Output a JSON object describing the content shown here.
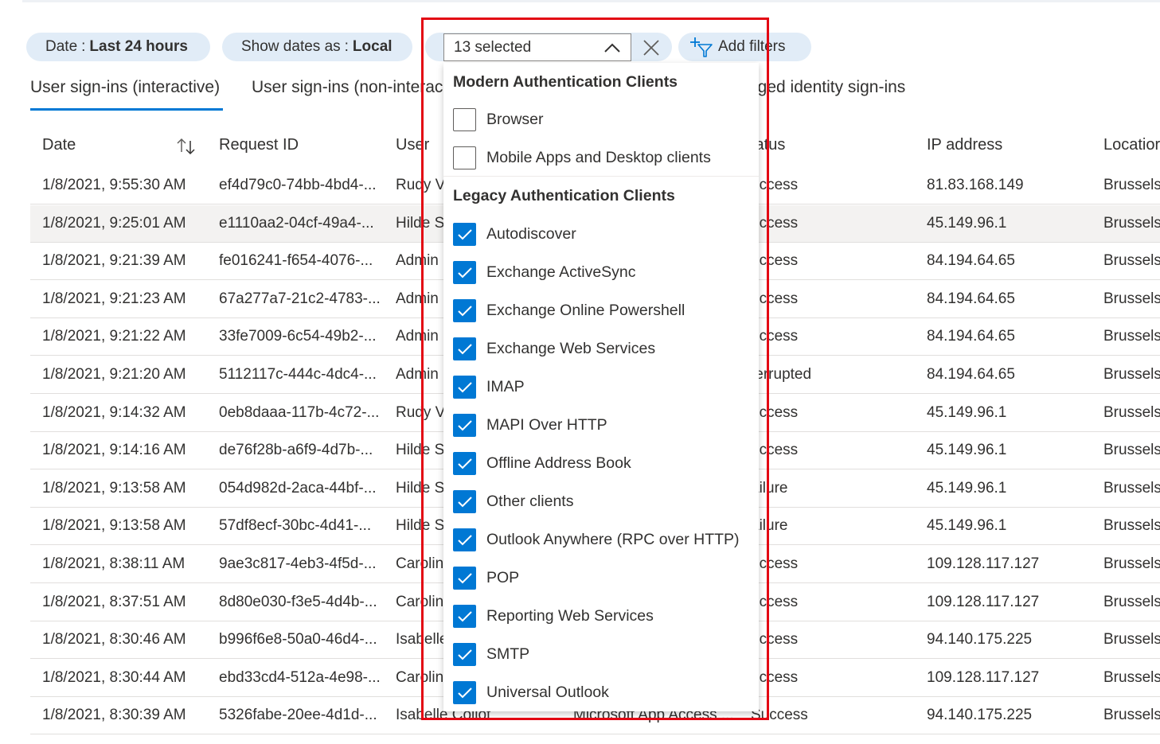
{
  "filters": {
    "date": {
      "key": "Date",
      "sep": ":",
      "value": "Last 24 hours"
    },
    "show_dates": {
      "key": "Show dates as",
      "sep": ":",
      "value": "Local"
    },
    "client_app": {
      "selected_text": "13 selected"
    },
    "add_filters": "Add filters"
  },
  "tabs": [
    {
      "label": "User sign-ins (interactive)"
    },
    {
      "label": "User sign-ins (non-interac"
    },
    {
      "label": "aged identity sign-ins"
    }
  ],
  "table": {
    "columns": [
      "Date",
      "Request ID",
      "User",
      "",
      "tatus",
      "IP address",
      "Locatior"
    ],
    "rows": [
      {
        "date": "1/8/2021, 9:55:30 AM",
        "request_id": "ef4d79c0-74bb-4bd4-...",
        "user": "Rudy V",
        "app": "",
        "status": "uccess",
        "ip": "81.83.168.149",
        "location": "Brussels,"
      },
      {
        "date": "1/8/2021, 9:25:01 AM",
        "request_id": "e1110aa2-04cf-49a4-...",
        "user": "Hilde S",
        "app": "",
        "status": "uccess",
        "ip": "45.149.96.1",
        "location": "Brussels,"
      },
      {
        "date": "1/8/2021, 9:21:39 AM",
        "request_id": "fe016241-f654-4076-...",
        "user": "Admin",
        "app": "",
        "status": "uccess",
        "ip": "84.194.64.65",
        "location": "Brussels,"
      },
      {
        "date": "1/8/2021, 9:21:23 AM",
        "request_id": "67a277a7-21c2-4783-...",
        "user": "Admin",
        "app": "",
        "status": "uccess",
        "ip": "84.194.64.65",
        "location": "Brussels,"
      },
      {
        "date": "1/8/2021, 9:21:22 AM",
        "request_id": "33fe7009-6c54-49b2-...",
        "user": "Admin",
        "app": "",
        "status": "uccess",
        "ip": "84.194.64.65",
        "location": "Brussels,"
      },
      {
        "date": "1/8/2021, 9:21:20 AM",
        "request_id": "5112117c-444c-4dc4-...",
        "user": "Admin",
        "app": "",
        "status": "terrupted",
        "ip": "84.194.64.65",
        "location": "Brussels,"
      },
      {
        "date": "1/8/2021, 9:14:32 AM",
        "request_id": "0eb8daaa-117b-4c72-...",
        "user": "Rudy V",
        "app": "",
        "status": "uccess",
        "ip": "45.149.96.1",
        "location": "Brussels,"
      },
      {
        "date": "1/8/2021, 9:14:16 AM",
        "request_id": "de76f28b-a6f9-4d7b-...",
        "user": "Hilde S",
        "app": "",
        "status": "uccess",
        "ip": "45.149.96.1",
        "location": "Brussels,"
      },
      {
        "date": "1/8/2021, 9:13:58 AM",
        "request_id": "054d982d-2aca-44bf-...",
        "user": "Hilde S",
        "app": "",
        "status": "ailure",
        "ip": "45.149.96.1",
        "location": "Brussels,"
      },
      {
        "date": "1/8/2021, 9:13:58 AM",
        "request_id": "57df8ecf-30bc-4d41-...",
        "user": "Hilde S",
        "app": "",
        "status": "ailure",
        "ip": "45.149.96.1",
        "location": "Brussels,"
      },
      {
        "date": "1/8/2021, 8:38:11 AM",
        "request_id": "9ae3c817-4eb3-4f5d-...",
        "user": "Carolin",
        "app": "",
        "status": "uccess",
        "ip": "109.128.117.127",
        "location": "Brussels,"
      },
      {
        "date": "1/8/2021, 8:37:51 AM",
        "request_id": "8d80e030-f3e5-4d4b-...",
        "user": "Carolin",
        "app": "",
        "status": "uccess",
        "ip": "109.128.117.127",
        "location": "Brussels,"
      },
      {
        "date": "1/8/2021, 8:30:46 AM",
        "request_id": "b996f6e8-50a0-46d4-...",
        "user": "Isabelle",
        "app": "",
        "status": "uccess",
        "ip": "94.140.175.225",
        "location": "Brussels,"
      },
      {
        "date": "1/8/2021, 8:30:44 AM",
        "request_id": "ebd33cd4-512a-4e98-...",
        "user": "Carolin",
        "app": "",
        "status": "uccess",
        "ip": "109.128.117.127",
        "location": "Brussels,"
      },
      {
        "date": "1/8/2021, 8:30:39 AM",
        "request_id": "5326fabe-20ee-4d1d-...",
        "user": "Isabelle Collot",
        "app": "Microsoft App Access ...",
        "status": "Success",
        "ip": "94.140.175.225",
        "location": "Brussels,"
      }
    ]
  },
  "dropdown": {
    "groups": [
      {
        "title": "Modern Authentication Clients",
        "options": [
          {
            "label": "Browser",
            "checked": false
          },
          {
            "label": "Mobile Apps and Desktop clients",
            "checked": false
          }
        ]
      },
      {
        "title": "Legacy Authentication Clients",
        "options": [
          {
            "label": "Autodiscover",
            "checked": true
          },
          {
            "label": "Exchange ActiveSync",
            "checked": true
          },
          {
            "label": "Exchange Online Powershell",
            "checked": true
          },
          {
            "label": "Exchange Web Services",
            "checked": true
          },
          {
            "label": "IMAP",
            "checked": true
          },
          {
            "label": "MAPI Over HTTP",
            "checked": true
          },
          {
            "label": "Offline Address Book",
            "checked": true
          },
          {
            "label": "Other clients",
            "checked": true
          },
          {
            "label": "Outlook Anywhere (RPC over HTTP)",
            "checked": true
          },
          {
            "label": "POP",
            "checked": true
          },
          {
            "label": "Reporting Web Services",
            "checked": true
          },
          {
            "label": "SMTP",
            "checked": true
          },
          {
            "label": "Universal Outlook",
            "checked": true
          }
        ]
      }
    ]
  },
  "colors": {
    "accent": "#0078d4",
    "pill_bg": "#e1ecf7",
    "highlight": "#e30613",
    "row_hover": "#f3f2f1"
  },
  "icons": [
    "sort-icon",
    "chevron-up-icon",
    "close-icon",
    "add-filter-icon",
    "checkmark-icon"
  ]
}
